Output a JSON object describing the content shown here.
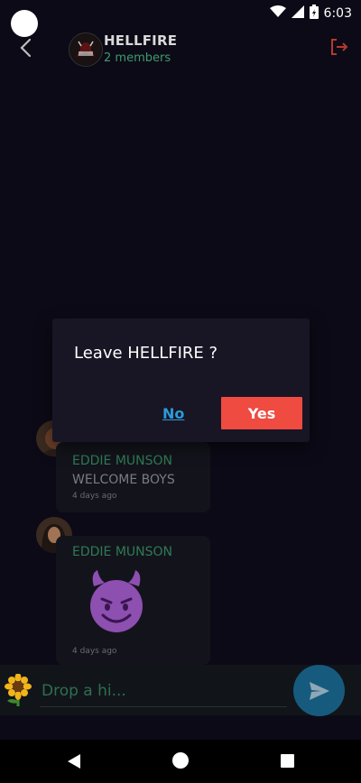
{
  "status_bar": {
    "time": "6:03",
    "icons": [
      "wifi-icon",
      "signal-icon",
      "battery-icon"
    ]
  },
  "header": {
    "group_name": "HELLFIRE",
    "members": "2 members",
    "icons": {
      "back": "chevron-left-icon",
      "leave": "logout-icon"
    }
  },
  "messages": [
    {
      "sender": "EDDIE MUNSON",
      "text": "WELCOME BOYS",
      "time": "4 days ago"
    },
    {
      "sender": "EDDIE MUNSON",
      "text": "😈",
      "time": "4 days ago"
    }
  ],
  "dialog": {
    "title": "Leave HELLFIRE ?",
    "no_label": "No",
    "yes_label": "Yes"
  },
  "input": {
    "placeholder": "Drop a hi...",
    "value": "",
    "emoji_button": "sunflower-icon",
    "send_icon": "send-icon"
  },
  "colors": {
    "accent_green": "#3e9b6d",
    "yes_button": "#ef4b41",
    "no_link": "#2c9ad8",
    "send_button": "#165b7d",
    "leave_icon": "#b33a2f"
  }
}
